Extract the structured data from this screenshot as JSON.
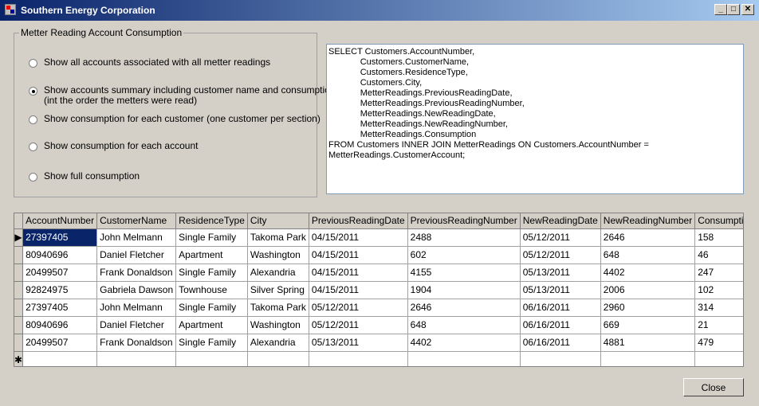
{
  "window": {
    "title": "Southern Energy Corporation"
  },
  "caption_buttons": {
    "minimize": "_",
    "maximize": "□",
    "close": "✕"
  },
  "group": {
    "title": "Metter Reading  Account Consumption",
    "options": [
      {
        "label": "Show all accounts associated with all metter readings",
        "checked": false
      },
      {
        "label": "Show accounts summary including customer name and consumption\n(int the order the metters were read)",
        "checked": true
      },
      {
        "label": "Show consumption for each customer (one customer per section)",
        "checked": false
      },
      {
        "label": "Show consumption for each account",
        "checked": false
      },
      {
        "label": "Show full consumption",
        "checked": false
      }
    ]
  },
  "sql": {
    "text": "SELECT Customers.AccountNumber,\n             Customers.CustomerName,\n             Customers.ResidenceType,\n             Customers.City,\n             MetterReadings.PreviousReadingDate,\n             MetterReadings.PreviousReadingNumber,\n             MetterReadings.NewReadingDate,\n             MetterReadings.NewReadingNumber,\n             MetterReadings.Consumption\nFROM Customers INNER JOIN MetterReadings ON Customers.AccountNumber =\nMetterReadings.CustomerAccount;"
  },
  "grid": {
    "columns": [
      "AccountNumber",
      "CustomerName",
      "ResidenceType",
      "City",
      "PreviousReadingDate",
      "PreviousReadingNumber",
      "NewReadingDate",
      "NewReadingNumber",
      "Consumption"
    ],
    "rows": [
      [
        "27397405",
        "John Melmann",
        "Single Family",
        "Takoma Park",
        "04/15/2011",
        "2488",
        "05/12/2011",
        "2646",
        "158"
      ],
      [
        "80940696",
        "Daniel Fletcher",
        "Apartment",
        "Washington",
        "04/15/2011",
        "602",
        "05/12/2011",
        "648",
        "46"
      ],
      [
        "20499507",
        "Frank Donaldson",
        "Single Family",
        "Alexandria",
        "04/15/2011",
        "4155",
        "05/13/2011",
        "4402",
        "247"
      ],
      [
        "92824975",
        "Gabriela Dawson",
        "Townhouse",
        "Silver Spring",
        "04/15/2011",
        "1904",
        "05/13/2011",
        "2006",
        "102"
      ],
      [
        "27397405",
        "John Melmann",
        "Single Family",
        "Takoma Park",
        "05/12/2011",
        "2646",
        "06/16/2011",
        "2960",
        "314"
      ],
      [
        "80940696",
        "Daniel Fletcher",
        "Apartment",
        "Washington",
        "05/12/2011",
        "648",
        "06/16/2011",
        "669",
        "21"
      ],
      [
        "20499507",
        "Frank Donaldson",
        "Single Family",
        "Alexandria",
        "05/13/2011",
        "4402",
        "06/16/2011",
        "4881",
        "479"
      ]
    ],
    "current_row_marker": "▶",
    "new_row_marker": "✱"
  },
  "buttons": {
    "close": "Close"
  }
}
